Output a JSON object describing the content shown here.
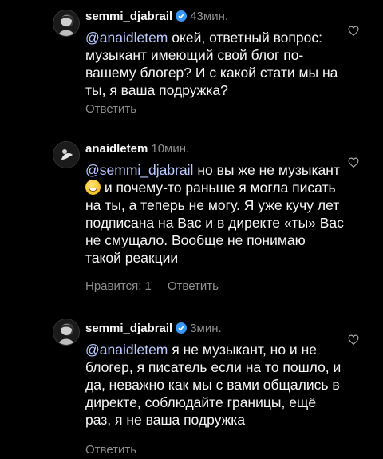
{
  "comments": [
    {
      "username": "semmi_djabrail",
      "verified": true,
      "time": "43мин.",
      "mention": "@anaidletem",
      "text_before_emoji": " окей, ответный вопрос: музыкант имеющий свой блог по-вашему блогер? И с какой стати мы на ты, я ваша подружка?",
      "text_after_emoji": "",
      "reply_label": "Ответить"
    },
    {
      "username": "anaidletem",
      "verified": false,
      "time": "10мин.",
      "mention": "@semmi_djabrail",
      "text_before_emoji": " но вы же не музыкант ",
      "emoji_name": "grinning-sweat-emoji",
      "text_after_emoji": " и почему-то раньше я могла писать на ты, а теперь не могу. Я уже кучу лет подписана на Вас и в директе «ты» Вас не смущало. Вообще не понимаю такой реакции",
      "likes_label": "Нравится: 1",
      "reply_label": "Ответить"
    },
    {
      "username": "semmi_djabrail",
      "verified": true,
      "time": "3мин.",
      "mention": "@anaidletem",
      "text_before_emoji": " я не музыкант, но и не блогер, я писатель если на то пошло, и да, неважно как мы с вами общались в директе, соблюдайте границы, ещё раз, я не ваша подружка",
      "text_after_emoji": "",
      "reply_label": "Ответить"
    }
  ],
  "colors": {
    "background": "#000000",
    "mention": "#b9c8ff",
    "muted": "#8e8e8e",
    "verified": "#3897f0"
  },
  "icons": [
    "heart-outline-icon",
    "verified-badge-icon"
  ]
}
